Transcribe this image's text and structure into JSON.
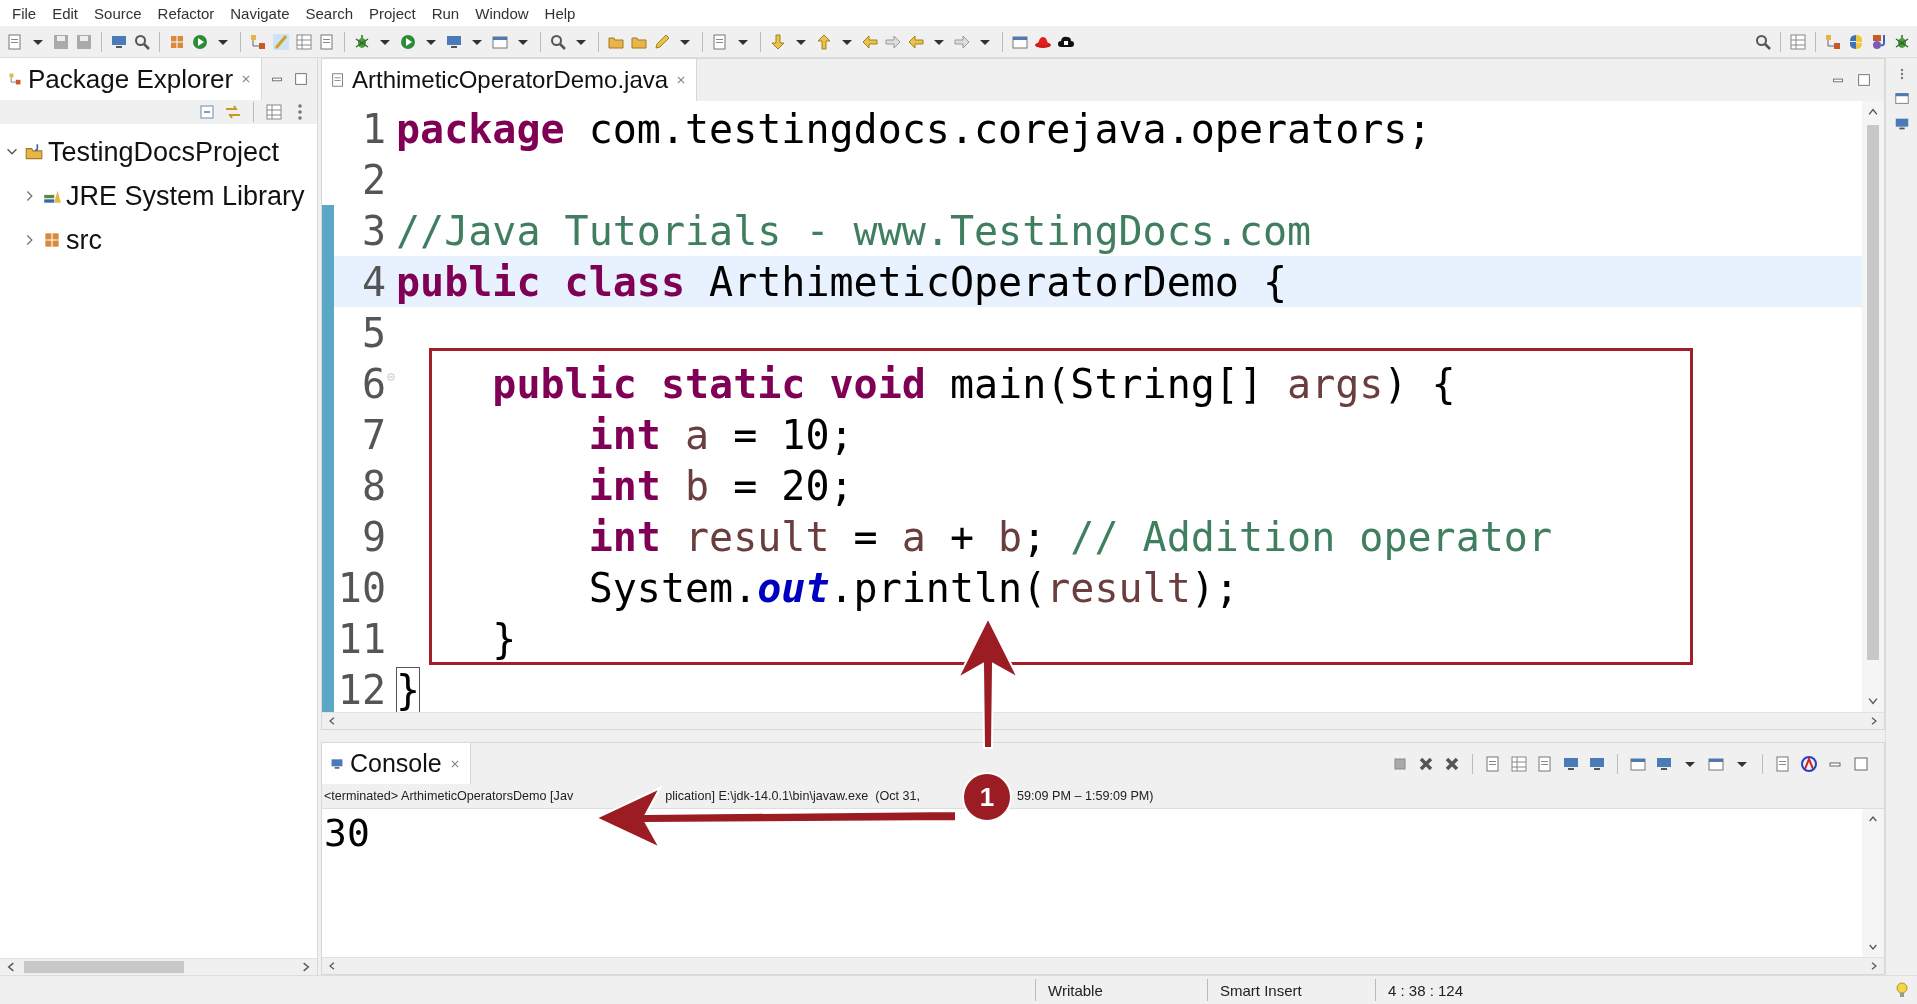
{
  "menu": [
    "File",
    "Edit",
    "Source",
    "Refactor",
    "Navigate",
    "Search",
    "Project",
    "Run",
    "Window",
    "Help"
  ],
  "package_explorer": {
    "title": "Package Explorer",
    "tree": [
      {
        "label": "TestingDocsProject",
        "expanded": true,
        "children": [
          {
            "label": "JRE System Library",
            "expanded": false
          },
          {
            "label": "src",
            "expanded": false
          }
        ]
      }
    ]
  },
  "editor": {
    "tab": {
      "label": "ArthimeticOperatorDemo.java",
      "selected": true
    },
    "lines": [
      {
        "number": "1",
        "current": false,
        "changed": false,
        "tokens": [
          {
            "kind": "keyword",
            "text": "package"
          },
          {
            "kind": "plain",
            "text": " com.testingdocs.corejava.operators;"
          }
        ]
      },
      {
        "number": "2",
        "current": false,
        "changed": false
      },
      {
        "number": "3",
        "current": false,
        "changed": true,
        "tokens": [
          {
            "kind": "comment",
            "text": "//Java Tutorials - www.TestingDocs.com"
          }
        ]
      },
      {
        "number": "4",
        "current": true,
        "changed": true,
        "tokens": [
          {
            "kind": "keyword",
            "text": "public class"
          },
          {
            "kind": "plain",
            "text": " ArthimeticOperatorDemo {"
          }
        ]
      },
      {
        "number": "5",
        "current": false,
        "changed": true
      },
      {
        "number": "6",
        "current": false,
        "changed": true,
        "folding": true,
        "tokens": [
          {
            "kind": "keyword",
            "text": "    public static void"
          },
          {
            "kind": "plain",
            "text": " main(String[] "
          },
          {
            "kind": "variable",
            "text": "args"
          },
          {
            "kind": "plain",
            "text": ") {"
          }
        ]
      },
      {
        "number": "7",
        "current": false,
        "changed": true,
        "tokens": [
          {
            "kind": "keyword",
            "text": "        int"
          },
          {
            "kind": "variable",
            "text": " a"
          },
          {
            "kind": "plain",
            "text": " = 10;"
          }
        ]
      },
      {
        "number": "8",
        "current": false,
        "changed": true,
        "tokens": [
          {
            "kind": "keyword",
            "text": "        int"
          },
          {
            "kind": "variable",
            "text": " b"
          },
          {
            "kind": "plain",
            "text": " = 20;"
          }
        ]
      },
      {
        "number": "9",
        "current": false,
        "changed": true,
        "tokens": [
          {
            "kind": "keyword",
            "text": "        int"
          },
          {
            "kind": "variable",
            "text": " result"
          },
          {
            "kind": "plain",
            "text": " = "
          },
          {
            "kind": "variable",
            "text": "a"
          },
          {
            "kind": "plain",
            "text": " + "
          },
          {
            "kind": "variable",
            "text": "b"
          },
          {
            "kind": "plain",
            "text": "; "
          },
          {
            "kind": "comment",
            "text": "// Addition operator"
          }
        ]
      },
      {
        "number": "10",
        "current": false,
        "changed": true,
        "tokens": [
          {
            "kind": "plain",
            "text": "        System."
          },
          {
            "kind": "field",
            "text": "out"
          },
          {
            "kind": "plain",
            "text": ".println("
          },
          {
            "kind": "variable",
            "text": "result"
          },
          {
            "kind": "plain",
            "text": ");"
          }
        ]
      },
      {
        "number": "11",
        "current": false,
        "changed": true,
        "tokens": [
          {
            "kind": "plain",
            "text": "    }"
          }
        ]
      },
      {
        "number": "12",
        "current": false,
        "changed": true,
        "tokens": [
          {
            "kind": "bracket",
            "text": "}"
          }
        ]
      }
    ]
  },
  "console": {
    "tab": {
      "label": "Console",
      "selected": true
    },
    "header": [
      "<terminated> ArthimeticOperatorsDemo [Jav",
      "plication] E:\\jdk-14.0.1\\bin\\javaw.exe  (Oct 31,",
      "59:09 PM – 1:59:09 PM)"
    ],
    "output": "30"
  },
  "annotation": {
    "badge": "1"
  },
  "status_bar": [
    "Writable",
    "Smart Insert",
    "4 : 38 : 124"
  ]
}
